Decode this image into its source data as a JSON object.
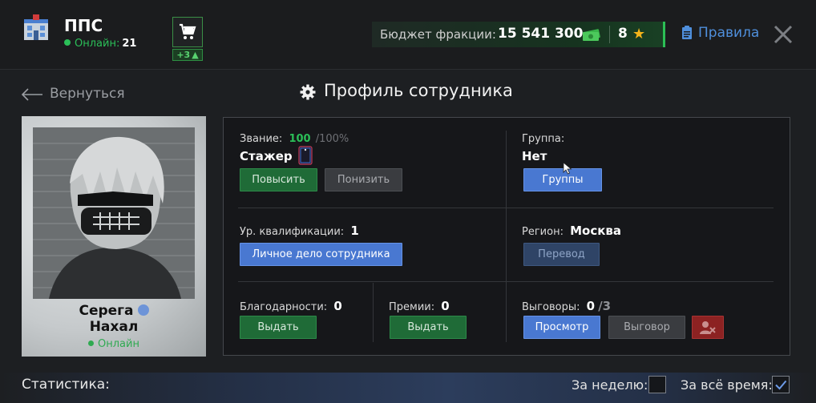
{
  "header": {
    "faction_name": "ППС",
    "online_label": "Онлайн:",
    "online_count": "21",
    "cart_badge": "+3",
    "budget_label": "Бюджет фракции:",
    "budget_value": "15 541 300",
    "stars_value": "8",
    "rules_label": "Правила"
  },
  "nav": {
    "back_label": "Вернуться",
    "page_title": "Профиль сотрудника"
  },
  "employee": {
    "first_name": "Серега",
    "last_name": "Нахал",
    "status": "Онлайн"
  },
  "rank": {
    "label": "Звание:",
    "progress": "100",
    "progress_max": "/100%",
    "name": "Стажер",
    "promote_button": "Повысить",
    "demote_button": "Понизить"
  },
  "group": {
    "label": "Группа:",
    "value": "Нет",
    "button": "Группы"
  },
  "qualification": {
    "label": "Ур. квалификации:",
    "value": "1",
    "button": "Личное дело сотрудника"
  },
  "region": {
    "label": "Регион:",
    "value": "Москва",
    "button": "Перевод"
  },
  "thanks": {
    "label": "Благодарности:",
    "value": "0",
    "button": "Выдать"
  },
  "bonuses": {
    "label": "Премии:",
    "value": "0",
    "button": "Выдать"
  },
  "reprimands": {
    "label": "Выговоры:",
    "value": "0",
    "max": "/3",
    "view_button": "Просмотр",
    "give_button": "Выговор"
  },
  "stats": {
    "label": "Статистика:",
    "week_label": "За неделю:",
    "week_checked": false,
    "all_time_label": "За всё время:",
    "all_time_checked": true
  },
  "colors": {
    "accent_blue": "#4978d1",
    "accent_green": "#1f6b37",
    "online_green": "#2bbf58",
    "danger_red": "#8c2222",
    "star_gold": "#f4b41a"
  }
}
